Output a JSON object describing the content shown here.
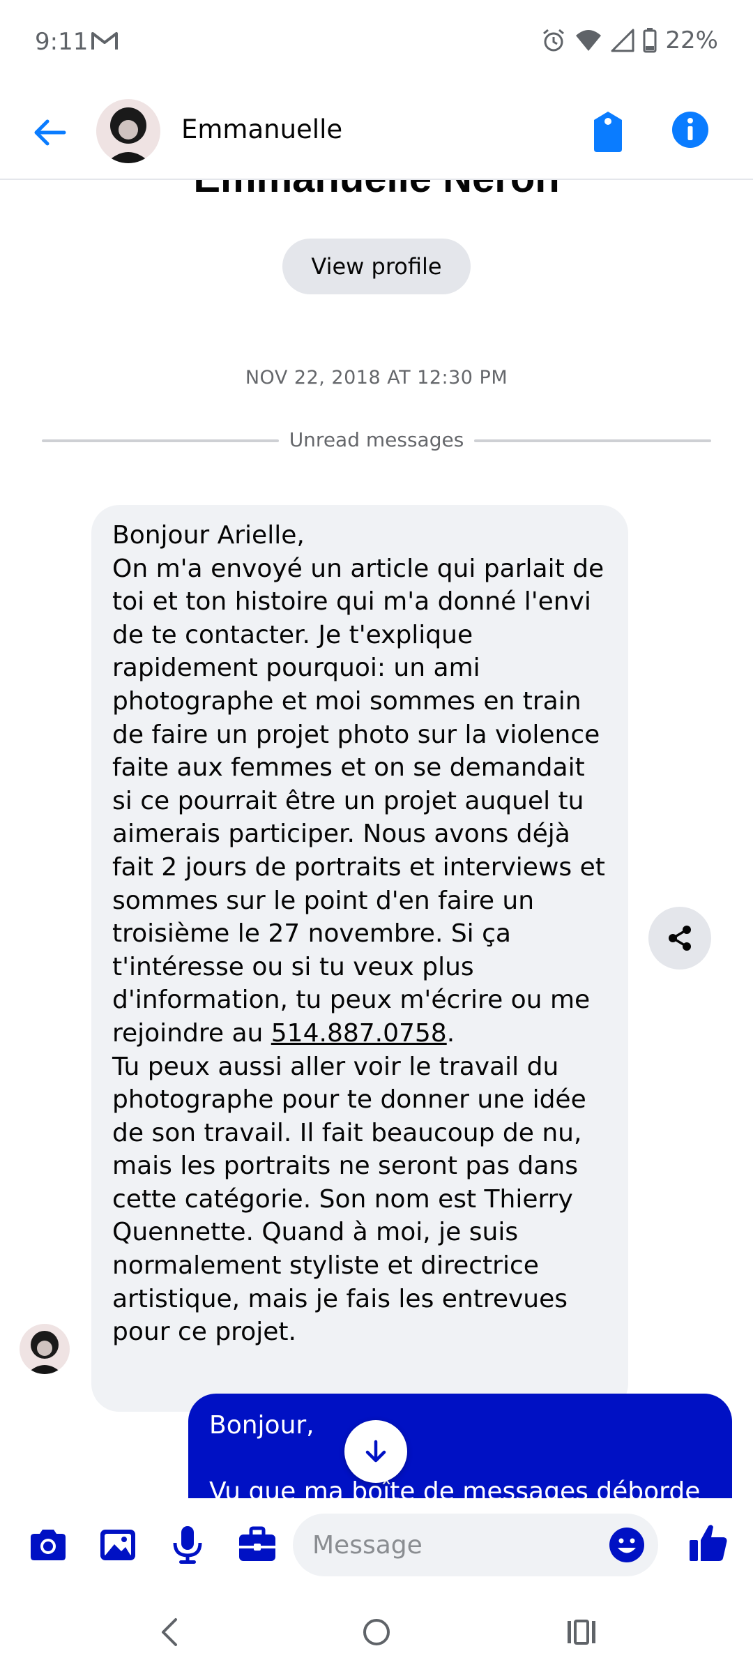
{
  "status_bar": {
    "time": "9:11",
    "battery": "22%",
    "icons": [
      "gmail-icon",
      "alarm-icon",
      "wifi-icon",
      "cellular-signal-icon",
      "battery-icon"
    ]
  },
  "header": {
    "contact_name": "Emmanuelle",
    "icons": [
      "back-arrow-icon",
      "avatar",
      "tag-icon",
      "info-icon"
    ]
  },
  "thread": {
    "profile_name": "Emmanuelle Neron",
    "view_profile_label": "View profile",
    "timestamp": "NOV 22, 2018 AT 12:30 PM",
    "unread_label": "Unread messages",
    "incoming_message": {
      "text_before_phone": "Bonjour Arielle,\nOn m'a envoyé un article qui parlait de toi et ton histoire qui m'a donné l'envi de te contacter. Je t'explique rapidement pourquoi: un ami photographe et moi sommes en train de faire un projet photo sur la violence faite aux femmes et on se demandait si ce pourrait être un projet auquel tu aimerais participer. Nous avons déjà fait 2 jours de portraits et interviews et sommes sur le point d'en faire un troisième le 27 novembre. Si ça t'intéresse ou si tu veux plus d'information, tu peux m'écrire ou me rejoindre au ",
      "phone": "514.887.0758",
      "text_after_phone": ".\nTu peux aussi aller voir le travail du photographe pour te donner une idée de son travail. Il fait beaucoup de nu, mais les portraits ne seront pas dans cette catégorie. Son nom est Thierry Quennette. Quand à moi, je suis normalement styliste et directrice artistique, mais je fais les entrevues pour ce projet."
    },
    "outgoing_message": {
      "text": "Bonjour,\n\nVu que ma boîte de messages déborde"
    }
  },
  "composer": {
    "placeholder": "Message",
    "icons": [
      "camera-icon",
      "gallery-icon",
      "microphone-icon",
      "briefcase-icon",
      "emoji-icon",
      "thumbs-up-icon"
    ]
  },
  "nav_bar": {
    "icons": [
      "back-nav-icon",
      "home-nav-icon",
      "recents-nav-icon"
    ]
  },
  "colors": {
    "accent": "#0011c4",
    "header_icon_blue": "#0a7cff",
    "bubble_incoming": "#f0f2f5",
    "bubble_outgoing": "#0011c4",
    "muted_text": "#65676b"
  }
}
